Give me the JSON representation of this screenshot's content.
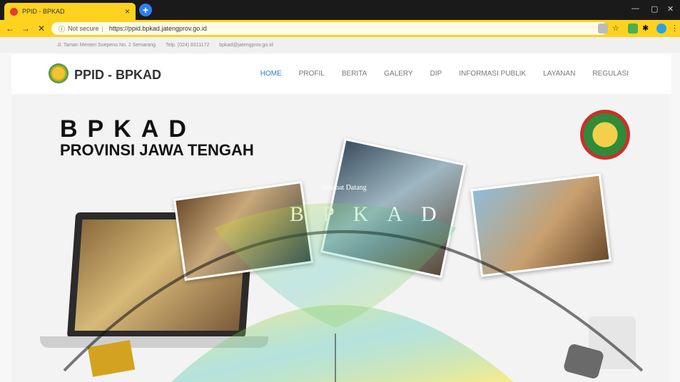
{
  "browser": {
    "tab_title": "PPID - BPKAD",
    "url_prefix": "Not secure",
    "url": "https://ppid.bpkad.jatengprov.go.id"
  },
  "topinfo": {
    "address": "Jl. Taman Menteri Soepeno No. 2 Semarang",
    "phone": "Telp. (024) 8311172",
    "email": "bpkad@jatengprov.go.id"
  },
  "site": {
    "brand": "PPID - BPKAD",
    "menu": [
      "HOME",
      "PROFIL",
      "BERITA",
      "GALERY",
      "DIP",
      "INFORMASI PUBLIK",
      "LAYANAN",
      "REGULASI"
    ]
  },
  "hero": {
    "title": "BPKAD",
    "subtitle": "PROVINSI JAWA TENGAH",
    "welcome": "Selamat Datang",
    "welcome_big": "BPKAD"
  }
}
